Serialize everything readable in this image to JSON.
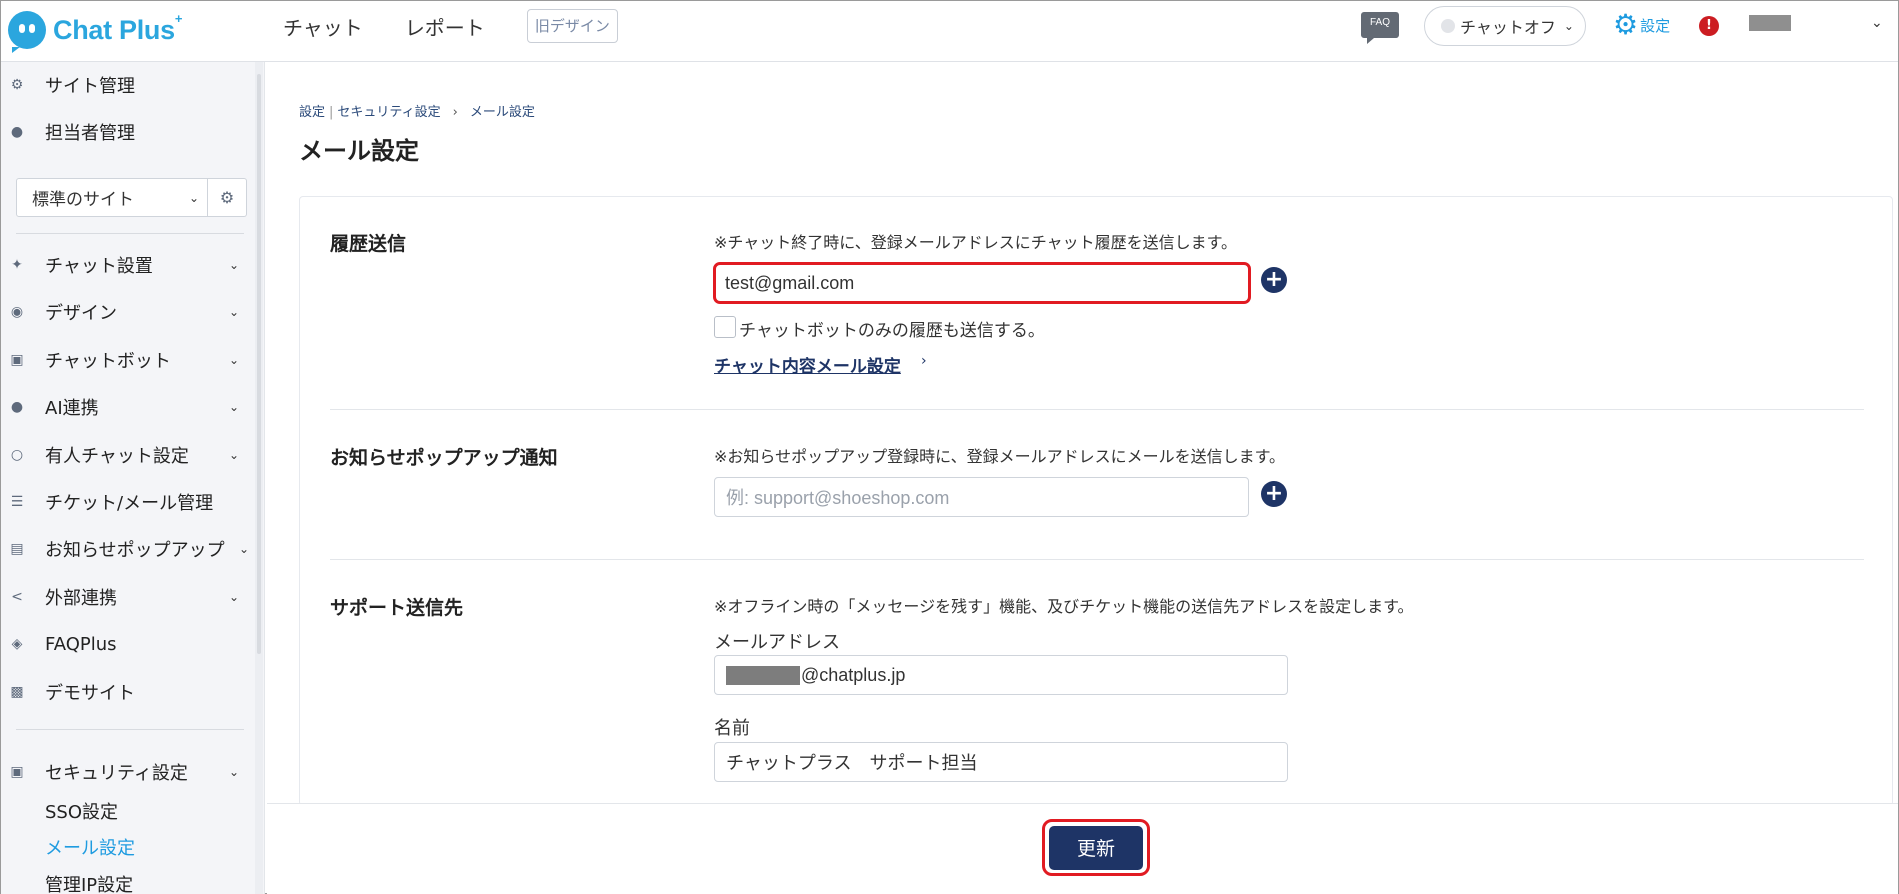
{
  "header": {
    "logo_text": "Chat Plus",
    "logo_sup": "+",
    "nav": [
      "チャット",
      "レポート"
    ],
    "old_design": "旧デザイン",
    "faq_badge": "FAQ",
    "chat_status": "チャットオフ",
    "settings_label": "設定",
    "alert_symbol": "!"
  },
  "sidebar": {
    "top_items": [
      {
        "label": "サイト管理",
        "icon": "gear-icon"
      },
      {
        "label": "担当者管理",
        "icon": "user-gear-icon"
      }
    ],
    "site_select": "標準のサイト",
    "items": [
      {
        "label": "チャット設置",
        "icon": "tools-icon"
      },
      {
        "label": "デザイン",
        "icon": "palette-icon"
      },
      {
        "label": "チャットボット",
        "icon": "chat-icon"
      },
      {
        "label": "AI連携",
        "icon": "bulb-icon"
      },
      {
        "label": "有人チャット設定",
        "icon": "headset-icon"
      },
      {
        "label": "チケット/メール管理",
        "icon": "list-icon"
      },
      {
        "label": "お知らせポップアップ",
        "icon": "popup-icon"
      },
      {
        "label": "外部連携",
        "icon": "share-icon"
      },
      {
        "label": "FAQPlus",
        "icon": "faqplus-icon"
      },
      {
        "label": "デモサイト",
        "icon": "demo-icon"
      }
    ],
    "security": {
      "label": "セキュリティ設定",
      "icon": "shield-icon"
    },
    "security_sub": [
      "SSO設定",
      "メール設定",
      "管理IP設定"
    ]
  },
  "breadcrumb": {
    "parts": [
      "設定",
      "セキュリティ設定"
    ],
    "current": "メール設定"
  },
  "page_title": "メール設定",
  "history": {
    "title": "履歴送信",
    "hint": "※チャット終了時に、登録メールアドレスにチャット履歴を送信します。",
    "email_value": "test@gmail.com",
    "checkbox_label": "チャットボットのみの履歴も送信する。",
    "link_label": "チャット内容メール設定",
    "link_arrow": "›"
  },
  "popup_notice": {
    "title": "お知らせポップアップ通知",
    "hint": "※お知らせポップアップ登録時に、登録メールアドレスにメールを送信します。",
    "placeholder": "例: support@shoeshop.com"
  },
  "support": {
    "title": "サポート送信先",
    "hint": "※オフライン時の「メッセージを残す」機能、及びチケット機能の送信先アドレスを設定します。",
    "email_label": "メールアドレス",
    "email_domain": "@chatplus.jp",
    "name_label": "名前",
    "name_value": "チャットプラス　サポート担当"
  },
  "update_button": "更新",
  "colors": {
    "accent": "#1e9be0",
    "navy": "#1e3466",
    "highlight": "#e11b22",
    "alert": "#cc1d22"
  }
}
